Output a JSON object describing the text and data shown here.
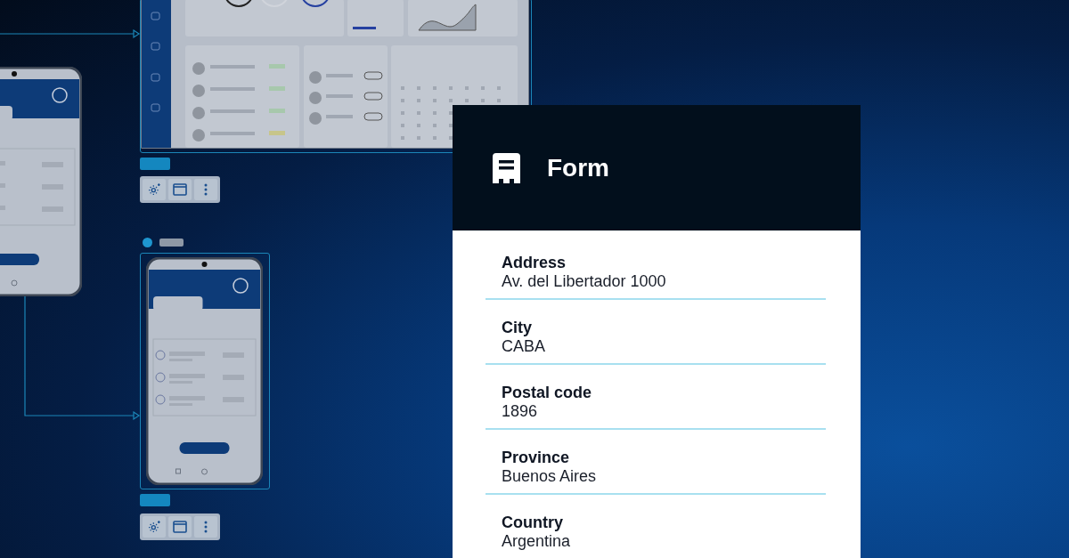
{
  "form": {
    "title": "Form",
    "fields": [
      {
        "label": "Address",
        "value": "Av. del Libertador 1000"
      },
      {
        "label": "City",
        "value": "CABA"
      },
      {
        "label": "Postal code",
        "value": "1896"
      },
      {
        "label": "Province",
        "value": "Buenos Aires"
      },
      {
        "label": "Country",
        "value": "Argentina"
      }
    ]
  }
}
